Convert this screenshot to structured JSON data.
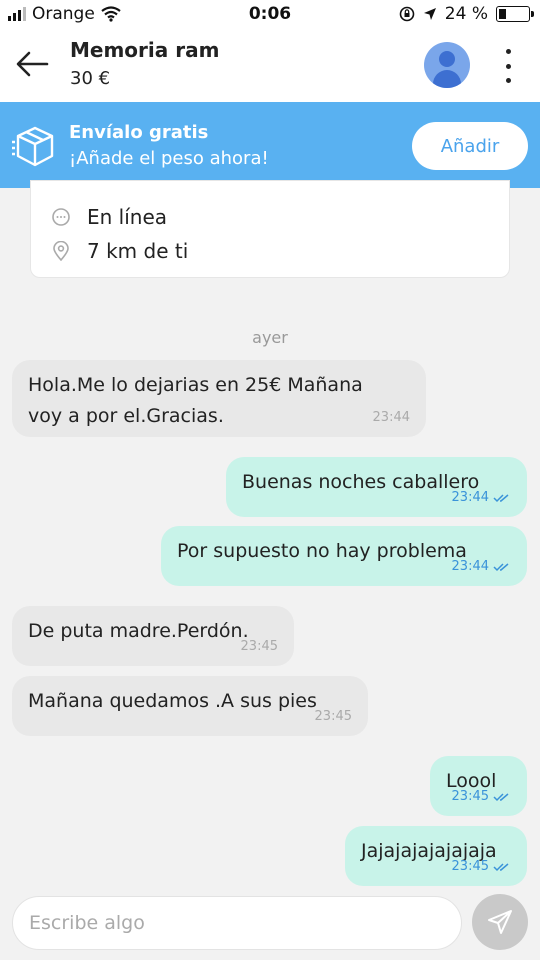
{
  "status_bar": {
    "carrier": "Orange",
    "time": "0:06",
    "battery": "24 %"
  },
  "header": {
    "title": "Memoria ram",
    "price": "30 €"
  },
  "banner": {
    "title": "Envíalo gratis",
    "subtitle": "¡Añade el peso ahora!",
    "button_label": "Añadir"
  },
  "info_card": {
    "status": "En línea",
    "distance": "7 km de ti"
  },
  "date_separator": "ayer",
  "messages": [
    {
      "direction": "in",
      "lines": [
        "Hola.Me lo dejarias en 25€ Mañana",
        "voy a por el.Gracias."
      ],
      "time": "23:44"
    },
    {
      "direction": "out",
      "lines": [
        "Buenas noches caballero"
      ],
      "time": "23:44",
      "read": true
    },
    {
      "direction": "out",
      "lines": [
        "Por supuesto no hay problema"
      ],
      "time": "23:44",
      "read": true
    },
    {
      "direction": "in",
      "lines": [
        "De puta madre.Perdón."
      ],
      "time": "23:45"
    },
    {
      "direction": "in",
      "lines": [
        "Mañana quedamos .A sus pies"
      ],
      "time": "23:45"
    },
    {
      "direction": "out",
      "lines": [
        "Loool"
      ],
      "time": "23:45",
      "read": true
    },
    {
      "direction": "out",
      "lines": [
        "Jajajajajajajaja"
      ],
      "time": "23:45",
      "read": true
    }
  ],
  "composer": {
    "placeholder": "Escribe algo"
  },
  "colors": {
    "banner": "#59b1f1",
    "outgoing_bubble": "#c8f3e9",
    "incoming_bubble": "#e8e8e8",
    "read_check": "#3a93d9"
  },
  "icons": [
    "signal-icon",
    "wifi-icon",
    "screen-lock-icon",
    "location-arrow-icon",
    "battery-icon",
    "back-arrow-icon",
    "avatar",
    "more-vertical-icon",
    "package-icon",
    "chat-bubble-icon",
    "location-pin-icon",
    "double-check-icon",
    "send-icon"
  ]
}
